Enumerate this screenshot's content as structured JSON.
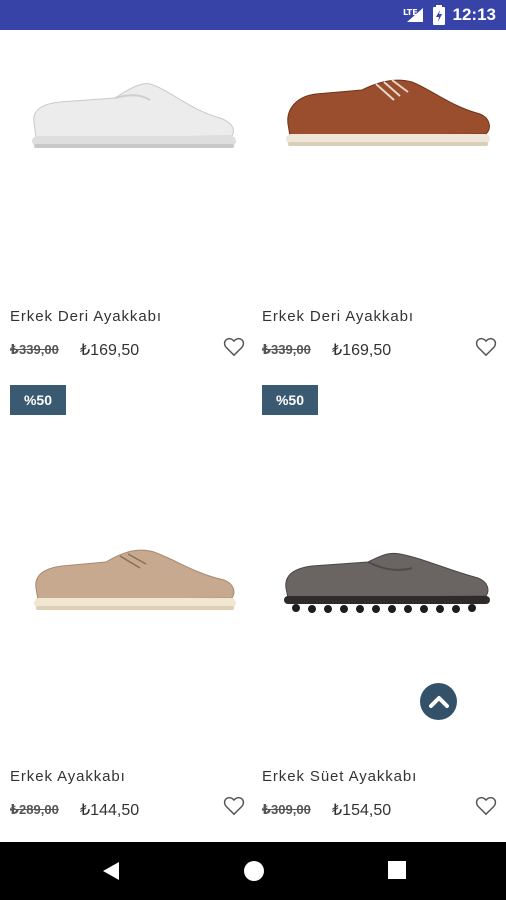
{
  "status_bar": {
    "network": "LTE",
    "time": "12:13"
  },
  "colors": {
    "status_bar": "#3843a8",
    "badge": "#3a5a72",
    "scroll_button": "#34516a",
    "nav_bar": "#000000"
  },
  "products": [
    {
      "name": "Erkek Deri Ayakkabı",
      "old_price": "₺339,00",
      "new_price": "₺169,50",
      "icon": "white-slip-on-shoe-image"
    },
    {
      "name": "Erkek Deri Ayakkabı",
      "old_price": "₺339,00",
      "new_price": "₺169,50",
      "icon": "brown-leather-shoe-image"
    },
    {
      "name": "Erkek Ayakkabı",
      "old_price": "₺289,00",
      "new_price": "₺144,50",
      "icon": "beige-suede-brogue-image",
      "badge": "%50"
    },
    {
      "name": "Erkek Süet Ayakkabı",
      "old_price": "₺309,00",
      "new_price": "₺154,50",
      "icon": "grey-suede-loafer-image",
      "badge": "%50"
    }
  ],
  "nav": {
    "back_icon": "back-triangle-icon",
    "home_icon": "home-circle-icon",
    "recents_icon": "recents-square-icon"
  }
}
